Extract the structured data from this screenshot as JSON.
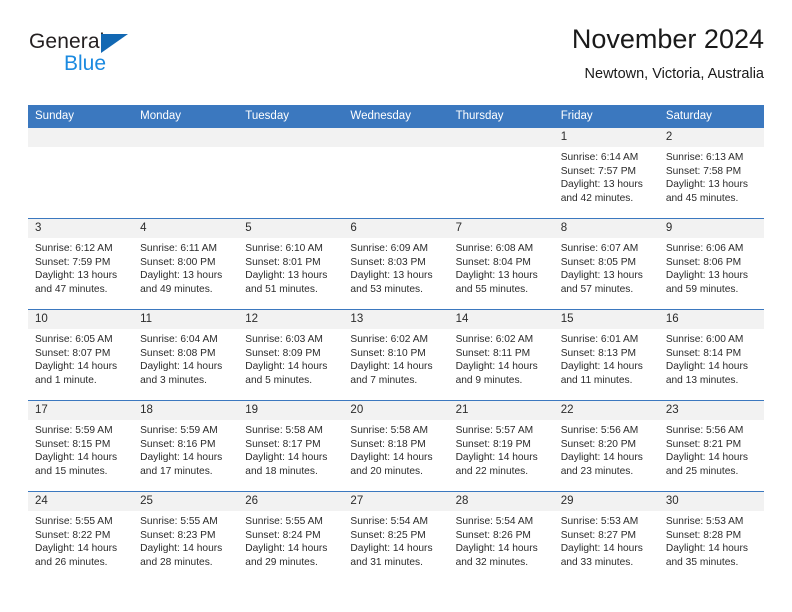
{
  "brand": {
    "name_part1": "General",
    "name_part2": "Blue",
    "logo_icon": "triangle-icon"
  },
  "header": {
    "title": "November 2024",
    "subtitle": "Newtown, Victoria, Australia"
  },
  "weekdays": [
    "Sunday",
    "Monday",
    "Tuesday",
    "Wednesday",
    "Thursday",
    "Friday",
    "Saturday"
  ],
  "colors": {
    "header_blue": "#3b78bf",
    "band_gray": "#f2f2f2",
    "brand_dark": "#231f20",
    "brand_blue": "#1b8ae0",
    "logo_blue": "#1268b3",
    "text": "#2b2b2b"
  },
  "labels": {
    "sunrise_prefix": "Sunrise:",
    "sunset_prefix": "Sunset:",
    "daylight_prefix": "Daylight:"
  },
  "weeks": [
    {
      "days": [
        {
          "num": "",
          "empty": true,
          "sunrise": "",
          "sunset": "",
          "daylight_line1": "",
          "daylight_line2": ""
        },
        {
          "num": "",
          "empty": true,
          "sunrise": "",
          "sunset": "",
          "daylight_line1": "",
          "daylight_line2": ""
        },
        {
          "num": "",
          "empty": true,
          "sunrise": "",
          "sunset": "",
          "daylight_line1": "",
          "daylight_line2": ""
        },
        {
          "num": "",
          "empty": true,
          "sunrise": "",
          "sunset": "",
          "daylight_line1": "",
          "daylight_line2": ""
        },
        {
          "num": "",
          "empty": true,
          "sunrise": "",
          "sunset": "",
          "daylight_line1": "",
          "daylight_line2": ""
        },
        {
          "num": "1",
          "empty": false,
          "sunrise": "Sunrise: 6:14 AM",
          "sunset": "Sunset: 7:57 PM",
          "daylight_line1": "Daylight: 13 hours",
          "daylight_line2": "and 42 minutes."
        },
        {
          "num": "2",
          "empty": false,
          "sunrise": "Sunrise: 6:13 AM",
          "sunset": "Sunset: 7:58 PM",
          "daylight_line1": "Daylight: 13 hours",
          "daylight_line2": "and 45 minutes."
        }
      ]
    },
    {
      "days": [
        {
          "num": "3",
          "empty": false,
          "sunrise": "Sunrise: 6:12 AM",
          "sunset": "Sunset: 7:59 PM",
          "daylight_line1": "Daylight: 13 hours",
          "daylight_line2": "and 47 minutes."
        },
        {
          "num": "4",
          "empty": false,
          "sunrise": "Sunrise: 6:11 AM",
          "sunset": "Sunset: 8:00 PM",
          "daylight_line1": "Daylight: 13 hours",
          "daylight_line2": "and 49 minutes."
        },
        {
          "num": "5",
          "empty": false,
          "sunrise": "Sunrise: 6:10 AM",
          "sunset": "Sunset: 8:01 PM",
          "daylight_line1": "Daylight: 13 hours",
          "daylight_line2": "and 51 minutes."
        },
        {
          "num": "6",
          "empty": false,
          "sunrise": "Sunrise: 6:09 AM",
          "sunset": "Sunset: 8:03 PM",
          "daylight_line1": "Daylight: 13 hours",
          "daylight_line2": "and 53 minutes."
        },
        {
          "num": "7",
          "empty": false,
          "sunrise": "Sunrise: 6:08 AM",
          "sunset": "Sunset: 8:04 PM",
          "daylight_line1": "Daylight: 13 hours",
          "daylight_line2": "and 55 minutes."
        },
        {
          "num": "8",
          "empty": false,
          "sunrise": "Sunrise: 6:07 AM",
          "sunset": "Sunset: 8:05 PM",
          "daylight_line1": "Daylight: 13 hours",
          "daylight_line2": "and 57 minutes."
        },
        {
          "num": "9",
          "empty": false,
          "sunrise": "Sunrise: 6:06 AM",
          "sunset": "Sunset: 8:06 PM",
          "daylight_line1": "Daylight: 13 hours",
          "daylight_line2": "and 59 minutes."
        }
      ]
    },
    {
      "days": [
        {
          "num": "10",
          "empty": false,
          "sunrise": "Sunrise: 6:05 AM",
          "sunset": "Sunset: 8:07 PM",
          "daylight_line1": "Daylight: 14 hours",
          "daylight_line2": "and 1 minute."
        },
        {
          "num": "11",
          "empty": false,
          "sunrise": "Sunrise: 6:04 AM",
          "sunset": "Sunset: 8:08 PM",
          "daylight_line1": "Daylight: 14 hours",
          "daylight_line2": "and 3 minutes."
        },
        {
          "num": "12",
          "empty": false,
          "sunrise": "Sunrise: 6:03 AM",
          "sunset": "Sunset: 8:09 PM",
          "daylight_line1": "Daylight: 14 hours",
          "daylight_line2": "and 5 minutes."
        },
        {
          "num": "13",
          "empty": false,
          "sunrise": "Sunrise: 6:02 AM",
          "sunset": "Sunset: 8:10 PM",
          "daylight_line1": "Daylight: 14 hours",
          "daylight_line2": "and 7 minutes."
        },
        {
          "num": "14",
          "empty": false,
          "sunrise": "Sunrise: 6:02 AM",
          "sunset": "Sunset: 8:11 PM",
          "daylight_line1": "Daylight: 14 hours",
          "daylight_line2": "and 9 minutes."
        },
        {
          "num": "15",
          "empty": false,
          "sunrise": "Sunrise: 6:01 AM",
          "sunset": "Sunset: 8:13 PM",
          "daylight_line1": "Daylight: 14 hours",
          "daylight_line2": "and 11 minutes."
        },
        {
          "num": "16",
          "empty": false,
          "sunrise": "Sunrise: 6:00 AM",
          "sunset": "Sunset: 8:14 PM",
          "daylight_line1": "Daylight: 14 hours",
          "daylight_line2": "and 13 minutes."
        }
      ]
    },
    {
      "days": [
        {
          "num": "17",
          "empty": false,
          "sunrise": "Sunrise: 5:59 AM",
          "sunset": "Sunset: 8:15 PM",
          "daylight_line1": "Daylight: 14 hours",
          "daylight_line2": "and 15 minutes."
        },
        {
          "num": "18",
          "empty": false,
          "sunrise": "Sunrise: 5:59 AM",
          "sunset": "Sunset: 8:16 PM",
          "daylight_line1": "Daylight: 14 hours",
          "daylight_line2": "and 17 minutes."
        },
        {
          "num": "19",
          "empty": false,
          "sunrise": "Sunrise: 5:58 AM",
          "sunset": "Sunset: 8:17 PM",
          "daylight_line1": "Daylight: 14 hours",
          "daylight_line2": "and 18 minutes."
        },
        {
          "num": "20",
          "empty": false,
          "sunrise": "Sunrise: 5:58 AM",
          "sunset": "Sunset: 8:18 PM",
          "daylight_line1": "Daylight: 14 hours",
          "daylight_line2": "and 20 minutes."
        },
        {
          "num": "21",
          "empty": false,
          "sunrise": "Sunrise: 5:57 AM",
          "sunset": "Sunset: 8:19 PM",
          "daylight_line1": "Daylight: 14 hours",
          "daylight_line2": "and 22 minutes."
        },
        {
          "num": "22",
          "empty": false,
          "sunrise": "Sunrise: 5:56 AM",
          "sunset": "Sunset: 8:20 PM",
          "daylight_line1": "Daylight: 14 hours",
          "daylight_line2": "and 23 minutes."
        },
        {
          "num": "23",
          "empty": false,
          "sunrise": "Sunrise: 5:56 AM",
          "sunset": "Sunset: 8:21 PM",
          "daylight_line1": "Daylight: 14 hours",
          "daylight_line2": "and 25 minutes."
        }
      ]
    },
    {
      "days": [
        {
          "num": "24",
          "empty": false,
          "sunrise": "Sunrise: 5:55 AM",
          "sunset": "Sunset: 8:22 PM",
          "daylight_line1": "Daylight: 14 hours",
          "daylight_line2": "and 26 minutes."
        },
        {
          "num": "25",
          "empty": false,
          "sunrise": "Sunrise: 5:55 AM",
          "sunset": "Sunset: 8:23 PM",
          "daylight_line1": "Daylight: 14 hours",
          "daylight_line2": "and 28 minutes."
        },
        {
          "num": "26",
          "empty": false,
          "sunrise": "Sunrise: 5:55 AM",
          "sunset": "Sunset: 8:24 PM",
          "daylight_line1": "Daylight: 14 hours",
          "daylight_line2": "and 29 minutes."
        },
        {
          "num": "27",
          "empty": false,
          "sunrise": "Sunrise: 5:54 AM",
          "sunset": "Sunset: 8:25 PM",
          "daylight_line1": "Daylight: 14 hours",
          "daylight_line2": "and 31 minutes."
        },
        {
          "num": "28",
          "empty": false,
          "sunrise": "Sunrise: 5:54 AM",
          "sunset": "Sunset: 8:26 PM",
          "daylight_line1": "Daylight: 14 hours",
          "daylight_line2": "and 32 minutes."
        },
        {
          "num": "29",
          "empty": false,
          "sunrise": "Sunrise: 5:53 AM",
          "sunset": "Sunset: 8:27 PM",
          "daylight_line1": "Daylight: 14 hours",
          "daylight_line2": "and 33 minutes."
        },
        {
          "num": "30",
          "empty": false,
          "sunrise": "Sunrise: 5:53 AM",
          "sunset": "Sunset: 8:28 PM",
          "daylight_line1": "Daylight: 14 hours",
          "daylight_line2": "and 35 minutes."
        }
      ]
    }
  ]
}
